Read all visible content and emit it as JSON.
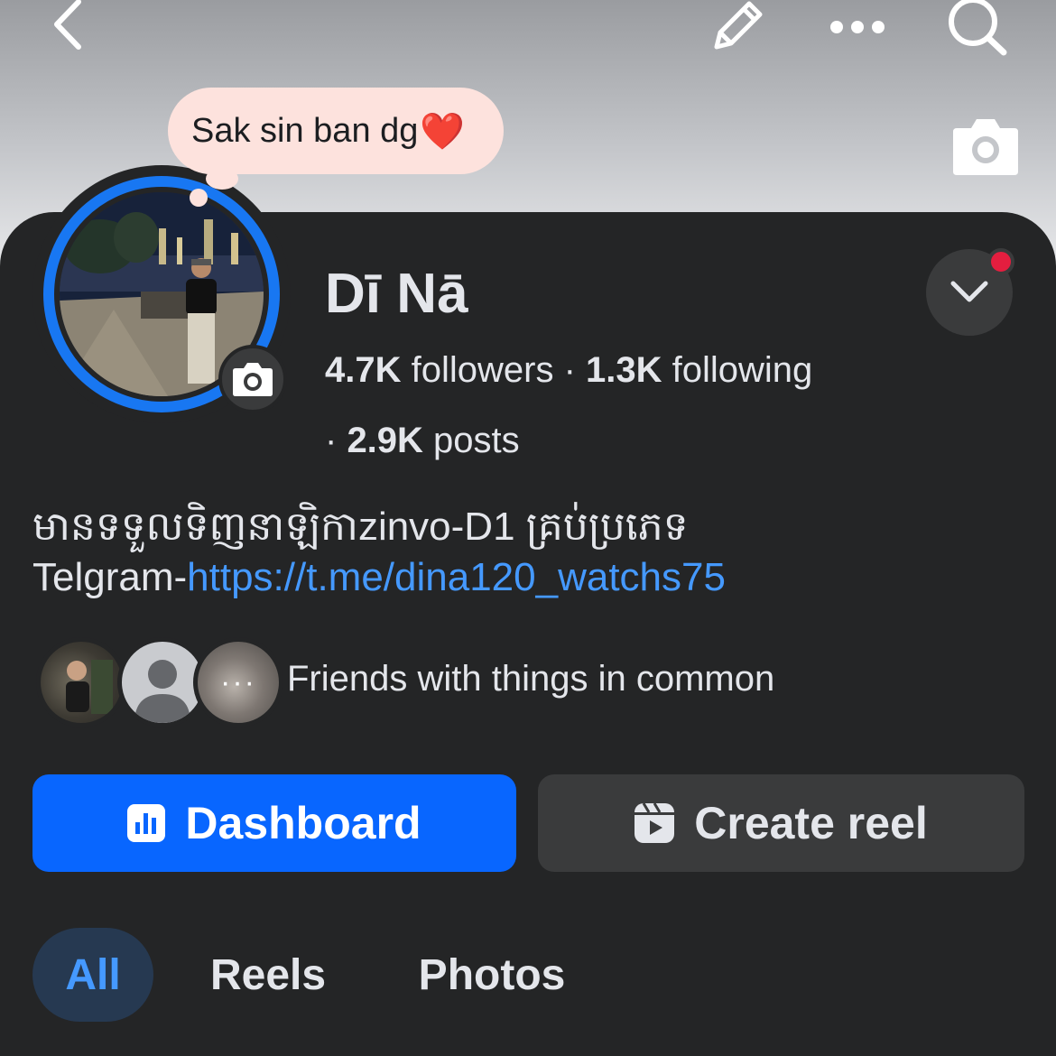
{
  "header": {
    "back_icon": "chevron-left-icon",
    "edit_icon": "pencil-icon",
    "more_icon": "more-horizontal-icon",
    "search_icon": "search-icon",
    "cover_camera_icon": "camera-icon"
  },
  "note": {
    "text": "Sak sin ban dg",
    "emoji": "❤️"
  },
  "profile": {
    "name": "Dī Nā",
    "followers_count": "4.7K",
    "followers_label": " followers",
    "following_count": "1.3K",
    "following_label": " following",
    "separator": " · ",
    "posts_prefix": "· ",
    "posts_count": "2.9K",
    "posts_label": " posts"
  },
  "bio": {
    "line1": "មានទទួលទិញនាឡិកាzinvo-D1 គ្រប់ប្រភេទ",
    "line2_prefix": "Telgram-",
    "link": "https://t.me/dina120_watchs75"
  },
  "friends": {
    "label": "Friends with things in common",
    "more": "···"
  },
  "actions": {
    "dashboard_label": "Dashboard",
    "create_reel_label": "Create reel"
  },
  "tabs": [
    {
      "label": "All",
      "active": true
    },
    {
      "label": "Reels",
      "active": false
    },
    {
      "label": "Photos",
      "active": false
    }
  ],
  "colors": {
    "accent": "#0866ff",
    "link": "#4599ff",
    "notification": "#e41e3f"
  }
}
